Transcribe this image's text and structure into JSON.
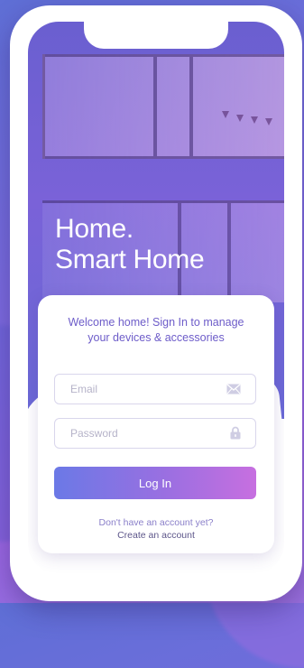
{
  "hero": {
    "title_line1": "Home.",
    "title_line2": "Smart Home"
  },
  "login": {
    "welcome_line1": "Welcome home! Sign In to manage",
    "welcome_line2": "your devices & accessories",
    "email": {
      "placeholder": "Email",
      "value": "",
      "icon": "envelope-icon"
    },
    "password": {
      "placeholder": "Password",
      "value": "",
      "icon": "lock-icon"
    },
    "login_button_label": "Log In",
    "signup_prompt": "Don't have an account yet?",
    "signup_link": "Create an account"
  },
  "colors": {
    "accent_start": "#6b79e6",
    "accent_end": "#c76fe0",
    "welcome_text": "#6d5cc9",
    "background": "#7d6be0"
  }
}
